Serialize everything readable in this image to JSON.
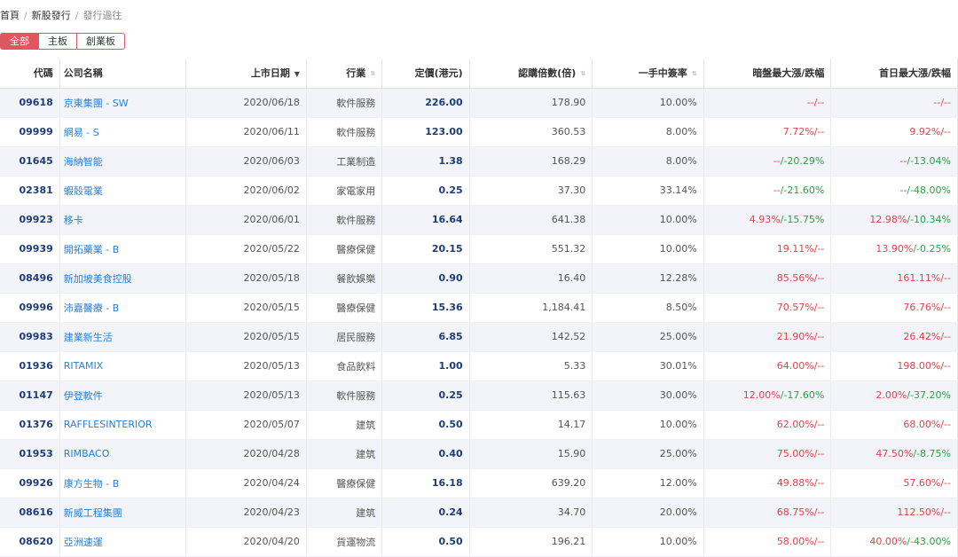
{
  "breadcrumb": {
    "home": "首頁",
    "ipo": "新股發行",
    "current": "發行過往",
    "sep": "/"
  },
  "filters": [
    "全部",
    "主板",
    "創業板"
  ],
  "colors": {
    "accent": "#e0555f",
    "link": "#2a7fd4",
    "code": "#1d3d78",
    "up": "#e0444c",
    "down": "#2ea044"
  },
  "headers": [
    "代碼",
    "公司名稱",
    "上市日期",
    "行業",
    "定價(港元)",
    "認購倍數(倍)",
    "一手中簽率",
    "暗盤最大漲/跌幅",
    "首日最大漲/跌幅"
  ],
  "rows": [
    {
      "code": "09618",
      "name": "京東集團 - SW",
      "date": "2020/06/18",
      "industry": "軟件服務",
      "price": "226.00",
      "sub": "178.90",
      "rate": "10.00%",
      "dark": [
        "--",
        "/--"
      ],
      "first": [
        "--",
        "/--"
      ]
    },
    {
      "code": "09999",
      "name": "網易 - S",
      "date": "2020/06/11",
      "industry": "軟件服務",
      "price": "123.00",
      "sub": "360.53",
      "rate": "8.00%",
      "dark": [
        "7.72%",
        "/--"
      ],
      "first": [
        "9.92%",
        "/--"
      ]
    },
    {
      "code": "01645",
      "name": "海納智能",
      "date": "2020/06/03",
      "industry": "工業制造",
      "price": "1.38",
      "sub": "168.29",
      "rate": "8.00%",
      "dark": [
        "--",
        "/-20.29%"
      ],
      "first": [
        "--",
        "/-13.04%"
      ]
    },
    {
      "code": "02381",
      "name": "蝦殼電業",
      "date": "2020/06/02",
      "industry": "家電家用",
      "price": "0.25",
      "sub": "37.30",
      "rate": "33.14%",
      "dark": [
        "--",
        "/-21.60%"
      ],
      "first": [
        "--",
        "/-48.00%"
      ]
    },
    {
      "code": "09923",
      "name": "移卡",
      "date": "2020/06/01",
      "industry": "軟件服務",
      "price": "16.64",
      "sub": "641.38",
      "rate": "10.00%",
      "dark": [
        "4.93%",
        "/-15.75%"
      ],
      "first": [
        "12.98%",
        "/-10.34%"
      ]
    },
    {
      "code": "09939",
      "name": "開拓藥業 - B",
      "date": "2020/05/22",
      "industry": "醫療保健",
      "price": "20.15",
      "sub": "551.32",
      "rate": "10.00%",
      "dark": [
        "19.11%",
        "/--"
      ],
      "first": [
        "13.90%",
        "/-0.25%"
      ]
    },
    {
      "code": "08496",
      "name": "新加坡美食控股",
      "date": "2020/05/18",
      "industry": "餐飲娛樂",
      "price": "0.90",
      "sub": "16.40",
      "rate": "12.28%",
      "dark": [
        "85.56%",
        "/--"
      ],
      "first": [
        "161.11%",
        "/--"
      ]
    },
    {
      "code": "09996",
      "name": "沛嘉醫療 - B",
      "date": "2020/05/15",
      "industry": "醫療保健",
      "price": "15.36",
      "sub": "1,184.41",
      "rate": "8.50%",
      "dark": [
        "70.57%",
        "/--"
      ],
      "first": [
        "76.76%",
        "/--"
      ]
    },
    {
      "code": "09983",
      "name": "建業新生活",
      "date": "2020/05/15",
      "industry": "居民服務",
      "price": "6.85",
      "sub": "142.52",
      "rate": "25.00%",
      "dark": [
        "21.90%",
        "/--"
      ],
      "first": [
        "26.42%",
        "/--"
      ]
    },
    {
      "code": "01936",
      "name": "RITAMIX",
      "date": "2020/05/13",
      "industry": "食品飲料",
      "price": "1.00",
      "sub": "5.33",
      "rate": "30.01%",
      "dark": [
        "64.00%",
        "/--"
      ],
      "first": [
        "198.00%",
        "/--"
      ]
    },
    {
      "code": "01147",
      "name": "伊登軟件",
      "date": "2020/05/13",
      "industry": "軟件服務",
      "price": "0.25",
      "sub": "115.63",
      "rate": "30.00%",
      "dark": [
        "12.00%",
        "/-17.60%"
      ],
      "first": [
        "2.00%",
        "/-37.20%"
      ]
    },
    {
      "code": "01376",
      "name": "RAFFLESINTERIOR",
      "date": "2020/05/07",
      "industry": "建筑",
      "price": "0.50",
      "sub": "14.17",
      "rate": "10.00%",
      "dark": [
        "62.00%",
        "/--"
      ],
      "first": [
        "68.00%",
        "/--"
      ]
    },
    {
      "code": "01953",
      "name": "RIMBACO",
      "date": "2020/04/28",
      "industry": "建筑",
      "price": "0.40",
      "sub": "15.90",
      "rate": "25.00%",
      "dark": [
        "75.00%",
        "/--"
      ],
      "first": [
        "47.50%",
        "/-8.75%"
      ]
    },
    {
      "code": "09926",
      "name": "康方生物 - B",
      "date": "2020/04/24",
      "industry": "醫療保健",
      "price": "16.18",
      "sub": "639.20",
      "rate": "12.00%",
      "dark": [
        "49.88%",
        "/--"
      ],
      "first": [
        "57.60%",
        "/--"
      ]
    },
    {
      "code": "08616",
      "name": "新威工程集團",
      "date": "2020/04/23",
      "industry": "建筑",
      "price": "0.24",
      "sub": "34.70",
      "rate": "20.00%",
      "dark": [
        "68.75%",
        "/--"
      ],
      "first": [
        "112.50%",
        "/--"
      ]
    },
    {
      "code": "08620",
      "name": "亞洲速運",
      "date": "2020/04/20",
      "industry": "貨運物流",
      "price": "0.50",
      "sub": "196.21",
      "rate": "10.00%",
      "dark": [
        "58.00%",
        "/--"
      ],
      "first": [
        "40.00%",
        "/-43.00%"
      ]
    }
  ]
}
